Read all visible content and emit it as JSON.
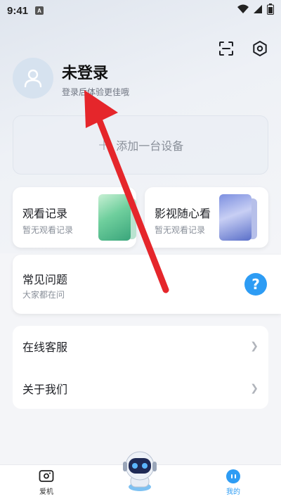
{
  "status_bar": {
    "time": "9:41",
    "notification_badge": "A"
  },
  "header": {
    "scan_icon": "scan-icon",
    "settings_icon": "settings-icon"
  },
  "profile": {
    "username": "未登录",
    "subtitle": "登录后体验更佳哦"
  },
  "add_device": {
    "label": "添加一台设备"
  },
  "cards": {
    "watch_history": {
      "title": "观看记录",
      "subtitle": "暂无观看记录"
    },
    "media": {
      "title": "影视随心看",
      "subtitle": "暂无观看记录"
    },
    "faq": {
      "title": "常见问题",
      "subtitle": "大家都在问",
      "icon": "?"
    }
  },
  "menu": {
    "items": [
      {
        "label": "在线客服"
      },
      {
        "label": "关于我们"
      }
    ]
  },
  "tabbar": {
    "tabs": [
      {
        "label": "爱机"
      },
      {
        "label": "我的",
        "active": true
      }
    ]
  },
  "colors": {
    "accent": "#2d9cf4",
    "annotation_arrow": "#e5262b"
  }
}
